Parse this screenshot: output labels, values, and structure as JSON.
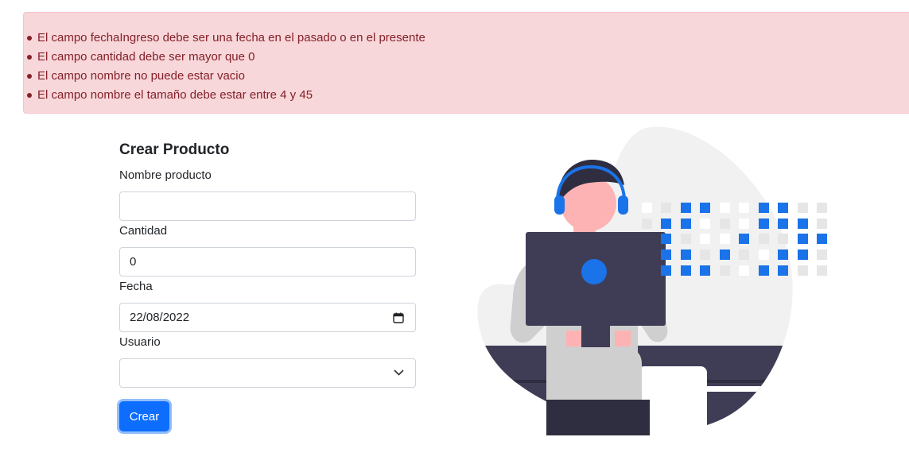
{
  "errors": [
    "El campo fechaIngreso debe ser una fecha en el pasado o en el presente",
    "El campo cantidad debe ser mayor que 0",
    "El campo nombre no puede estar vacio",
    "El campo nombre el tamaño debe estar entre 4 y 45"
  ],
  "form": {
    "title": "Crear Producto",
    "nombre_label": "Nombre producto",
    "nombre_value": "",
    "cantidad_label": "Cantidad",
    "cantidad_value": "0",
    "fecha_label": "Fecha",
    "fecha_value": "22/08/2022",
    "usuario_label": "Usuario",
    "usuario_value": "",
    "submit_label": "Crear"
  },
  "icons": {
    "date": "calendar-icon",
    "select": "chevron-down-icon",
    "illustration": "person-with-headset-at-computer-illustration"
  },
  "colors": {
    "alert_bg": "#f8d7da",
    "alert_text": "#842029",
    "primary": "#0d6efd"
  }
}
